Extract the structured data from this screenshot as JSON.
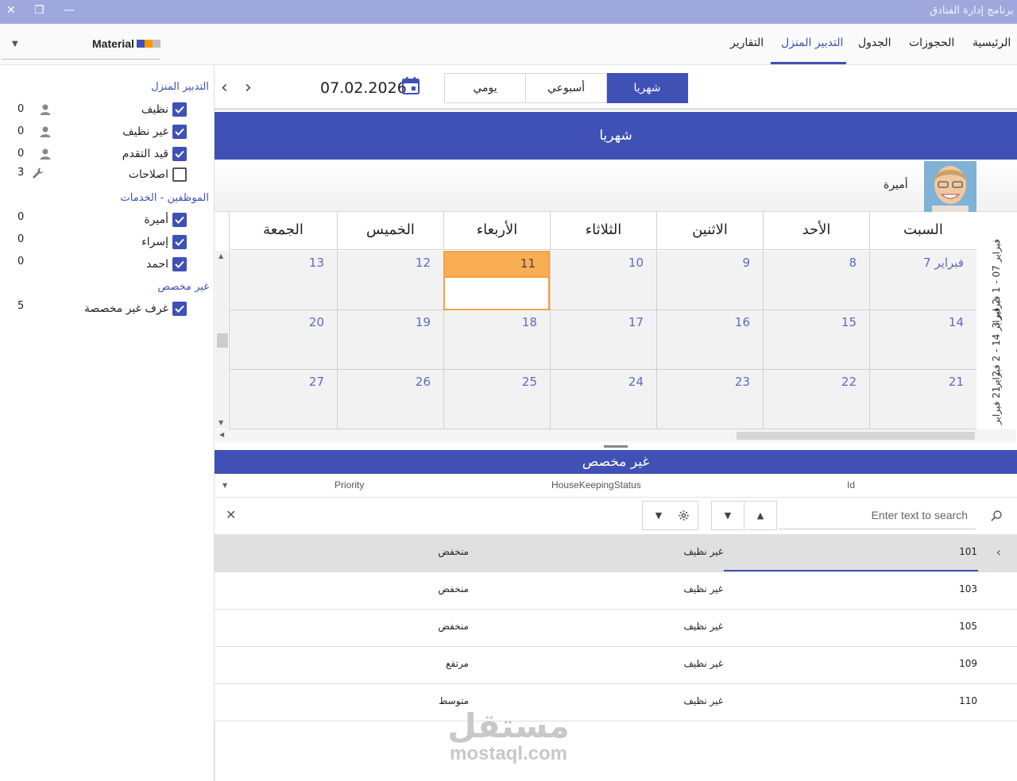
{
  "window": {
    "title": "برنامج إدارة الفنادق",
    "close_glyph": "✕",
    "restore_glyph": "❐",
    "minimize_glyph": "—"
  },
  "theme": {
    "label": "Material",
    "swatch_colors": [
      "#3f51b5",
      "#ff9800",
      "#bdbdbd"
    ]
  },
  "tabs": [
    {
      "label": "الرئيسية",
      "active": false
    },
    {
      "label": "الحجوزات",
      "active": false
    },
    {
      "label": "الجدول",
      "active": false
    },
    {
      "label": "التدبير المنزل",
      "active": true
    },
    {
      "label": "التقارير",
      "active": false
    }
  ],
  "filters": {
    "groups": [
      {
        "title": "التدبير المنزل",
        "items": [
          {
            "label": "نظيف",
            "count": "0",
            "checked": true,
            "icon": "user-icon"
          },
          {
            "label": "غير نظيف",
            "count": "0",
            "checked": true,
            "icon": "user-icon"
          },
          {
            "label": "قيد التقدم",
            "count": "0",
            "checked": true,
            "icon": "user-icon"
          },
          {
            "label": "اصلاحات",
            "count": "3",
            "checked": false,
            "icon": "wrench-icon"
          }
        ]
      },
      {
        "title": "الموظفين - الخدمات",
        "items": [
          {
            "label": "أميرة",
            "count": "0",
            "checked": true
          },
          {
            "label": "إسراء",
            "count": "0",
            "checked": true
          },
          {
            "label": "احمد",
            "count": "0",
            "checked": true
          }
        ]
      },
      {
        "title": "غير مخصص",
        "items": [
          {
            "label": "غرف غير مخصصة",
            "count": "5",
            "checked": true
          }
        ]
      }
    ]
  },
  "navigator": {
    "date": "07.02.2026",
    "views": [
      {
        "label": "شهريا",
        "active": true
      },
      {
        "label": "أسبوعي",
        "active": false
      },
      {
        "label": "يومي",
        "active": false
      }
    ]
  },
  "scheduler": {
    "header": "شهريا",
    "resource_name": "أميرة",
    "days": [
      "السبت",
      "الأحد",
      "الاثنين",
      "الثلاثاء",
      "الأربعاء",
      "الخميس",
      "الجمعة"
    ],
    "weeks": [
      {
        "label": "فبراير 07 - 1 فبراير 3",
        "dates": [
          "فبراير 7",
          "8",
          "9",
          "10",
          "11",
          "12",
          "13"
        ]
      },
      {
        "label": "2 فبراير 14 - 2 فبراير",
        "dates": [
          "14",
          "15",
          "16",
          "17",
          "18",
          "19",
          "20"
        ]
      },
      {
        "label": "2 - 21 فبراير",
        "dates": [
          "21",
          "22",
          "23",
          "24",
          "25",
          "26",
          "27"
        ]
      }
    ],
    "today_date": "11"
  },
  "grid": {
    "header": "غير مخصص",
    "columns": [
      "Priority",
      "HouseKeepingStatus",
      "Id"
    ],
    "search_placeholder": "Enter text to search",
    "rows": [
      {
        "id": "101",
        "status": "غير نظيف",
        "priority": "منخفض",
        "selected": true
      },
      {
        "id": "103",
        "status": "غير نظيف",
        "priority": "منخفض",
        "selected": false
      },
      {
        "id": "105",
        "status": "غير نظيف",
        "priority": "منخفض",
        "selected": false
      },
      {
        "id": "109",
        "status": "غير نظيف",
        "priority": "مرتفع",
        "selected": false
      },
      {
        "id": "110",
        "status": "غير نظيف",
        "priority": "متوسط",
        "selected": false
      }
    ]
  },
  "watermark": {
    "arabic": "مستقل",
    "latin": "mostaql.com"
  }
}
